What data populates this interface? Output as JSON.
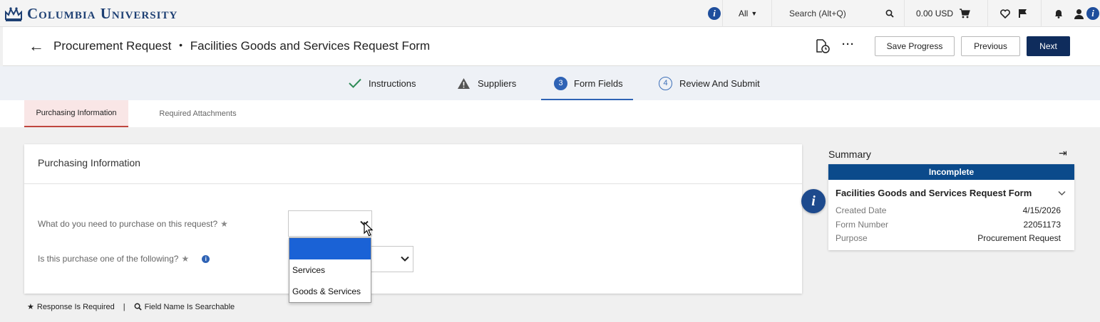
{
  "topbar": {
    "logo_text": "Columbia University",
    "scope_label": "All",
    "search_placeholder": "Search (Alt+Q)",
    "cart_total": "0.00 USD"
  },
  "header": {
    "title": "Procurement Request",
    "bullet": "•",
    "subtitle": "Facilities Goods and Services Request Form",
    "more_label": "···",
    "save_label": "Save Progress",
    "previous_label": "Previous",
    "next_label": "Next"
  },
  "steps": [
    {
      "num": "",
      "label": "Instructions"
    },
    {
      "num": "",
      "label": "Suppliers"
    },
    {
      "num": "3",
      "label": "Form Fields"
    },
    {
      "num": "4",
      "label": "Review And Submit"
    }
  ],
  "subtabs": [
    {
      "label": "Purchasing Information"
    },
    {
      "label": "Required Attachments"
    }
  ],
  "card": {
    "title": "Purchasing Information",
    "q1": "What do you need to purchase on this request?",
    "q2": "Is this purchase one of the following?",
    "q1_value": "",
    "dropdown_options": [
      "",
      "Services",
      "Goods & Services"
    ]
  },
  "legend": {
    "required": "Response Is Required",
    "divider": "|",
    "searchable": "Field Name Is Searchable"
  },
  "summary": {
    "title": "Summary",
    "status": "Incomplete",
    "form_name": "Facilities Goods and Services Request Form",
    "rows": [
      {
        "key": "Created Date",
        "value": "4/15/2026"
      },
      {
        "key": "Form Number",
        "value": "22051173"
      },
      {
        "key": "Purpose",
        "value": "Procurement Request"
      }
    ]
  },
  "colors": {
    "brand_navy": "#0f2c5c",
    "status_blue": "#0b4a8b",
    "step_active": "#2f63b5",
    "tab_accent": "#c0463f",
    "dropdown_highlight": "#1a62d6"
  }
}
